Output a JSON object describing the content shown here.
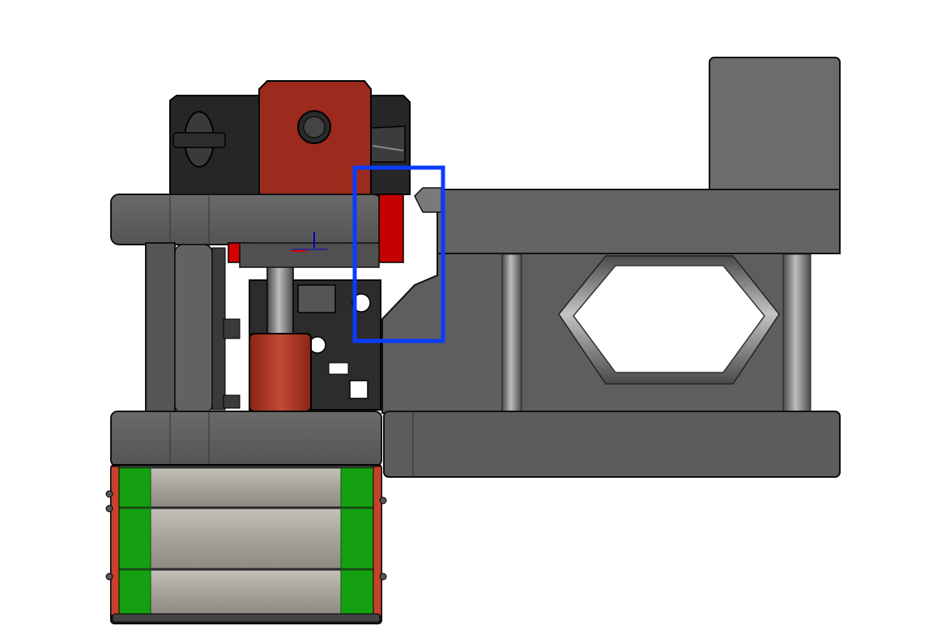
{
  "view": {
    "kind": "cad-render",
    "background": "#ffffff"
  },
  "colors": {
    "part_dark": "#222222",
    "part_gray": "#5a5a5a",
    "part_gray_light": "#6e6e6e",
    "part_red": "#a0301f",
    "part_red_bright": "#d40000",
    "rail_green": "#14a010",
    "rail_steel": "#a8a39c",
    "highlight_box": "#0a3cff",
    "axis_red": "#e00000",
    "axis_blue": "#0000c8"
  },
  "icons": {
    "triad": "axis-triad-icon"
  }
}
